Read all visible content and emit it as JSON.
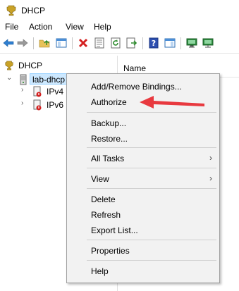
{
  "window": {
    "title": "DHCP"
  },
  "menubar": {
    "items": [
      "File",
      "Action",
      "View",
      "Help"
    ]
  },
  "tree": {
    "root_label": "DHCP",
    "server_label": "lab-dhcp",
    "children": [
      {
        "label": "IPv4"
      },
      {
        "label": "IPv6"
      }
    ]
  },
  "list": {
    "column_name": "Name"
  },
  "context_menu": {
    "items": [
      {
        "label": "Add/Remove Bindings..."
      },
      {
        "label": "Authorize"
      },
      {
        "label": "Backup..."
      },
      {
        "label": "Restore..."
      },
      {
        "label": "All Tasks",
        "submenu_glyph": "›"
      },
      {
        "label": "View",
        "submenu_glyph": "›"
      },
      {
        "label": "Delete"
      },
      {
        "label": "Refresh"
      },
      {
        "label": "Export List..."
      },
      {
        "label": "Properties"
      },
      {
        "label": "Help"
      }
    ]
  },
  "annotation": {
    "arrow_color": "#e8393f"
  },
  "icons": {
    "app": "trophy-icon",
    "back": "back-arrow-icon",
    "forward": "forward-arrow-icon",
    "up": "up-folder-icon",
    "console": "show-console-tree-icon",
    "delete": "delete-x-icon",
    "properties": "properties-icon",
    "refresh": "refresh-icon",
    "export": "export-list-icon",
    "help": "help-icon",
    "action_pane": "action-pane-icon",
    "monitor1": "monitor-icon",
    "monitor2": "monitor-network-icon"
  }
}
